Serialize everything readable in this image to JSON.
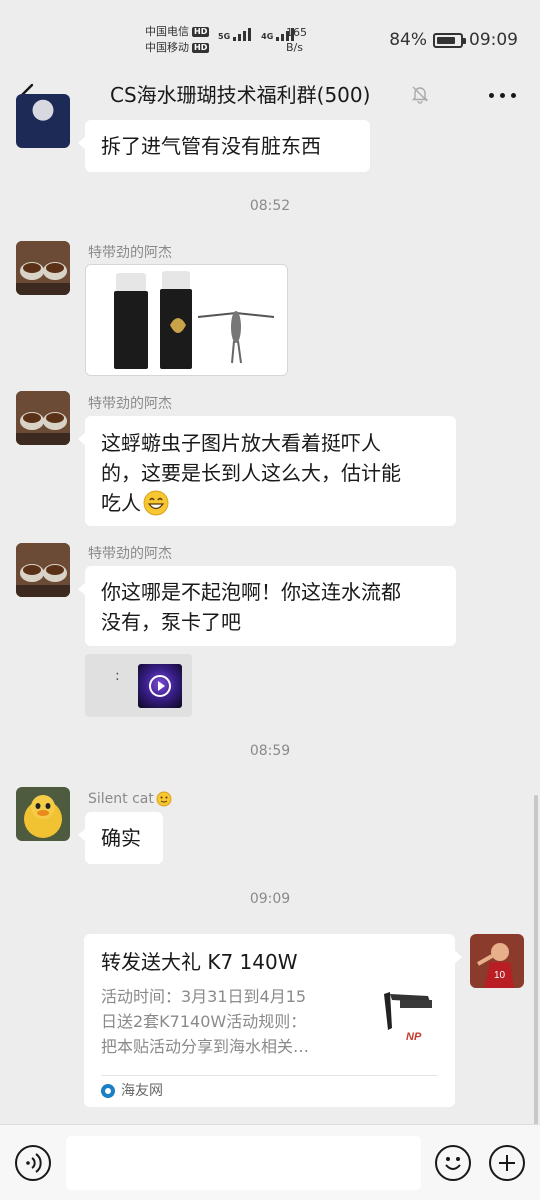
{
  "status_bar": {
    "carrier_1": "中国电信",
    "carrier_2": "中国移动",
    "hd_badge": "HD",
    "network_5g": "5G",
    "network_4g": "4G",
    "net_speed_value": "165",
    "net_speed_unit": "B/s",
    "battery_percent": "84%",
    "battery_level": 0.84,
    "time": "09:09"
  },
  "header": {
    "title": "CS海水珊瑚技术福利群(500)",
    "back_icon": "chevron-left-icon",
    "mute_icon": "bell-muted-icon",
    "more_icon": "more-dots-icon"
  },
  "messages": [
    {
      "type": "text",
      "text": "拆了进气管有没有脏东西"
    },
    {
      "type": "timestamp",
      "text": "08:52"
    },
    {
      "type": "image",
      "sender": "特带劲的阿杰"
    },
    {
      "type": "text",
      "sender": "特带劲的阿杰",
      "lines": [
        "这蜉蝣虫子图片放大看着挺吓人",
        "的，这要是长到人这么大，估计能",
        "吃人"
      ]
    },
    {
      "type": "text",
      "sender": "特带劲的阿杰",
      "lines": [
        "你这哪是不起泡啊！你这连水流都",
        "没有，泵卡了吧"
      ],
      "attachment_colon": ":"
    },
    {
      "type": "timestamp",
      "text": "08:59"
    },
    {
      "type": "text",
      "sender": "Silent cat",
      "text": "确实"
    },
    {
      "type": "timestamp",
      "text": "09:09"
    },
    {
      "type": "link_card",
      "title": "转发送大礼 K7 140W",
      "desc_lines": [
        "活动时间：3月31日到4月15",
        "日送2套K7140W活动规则：",
        "把本贴活动分享到海水相关…"
      ],
      "thumb_label": "NP",
      "source": "海友网"
    }
  ],
  "input_bar": {
    "placeholder": "",
    "voice_icon": "voice-icon",
    "emoji_icon": "emoji-icon",
    "plus_icon": "plus-icon"
  }
}
